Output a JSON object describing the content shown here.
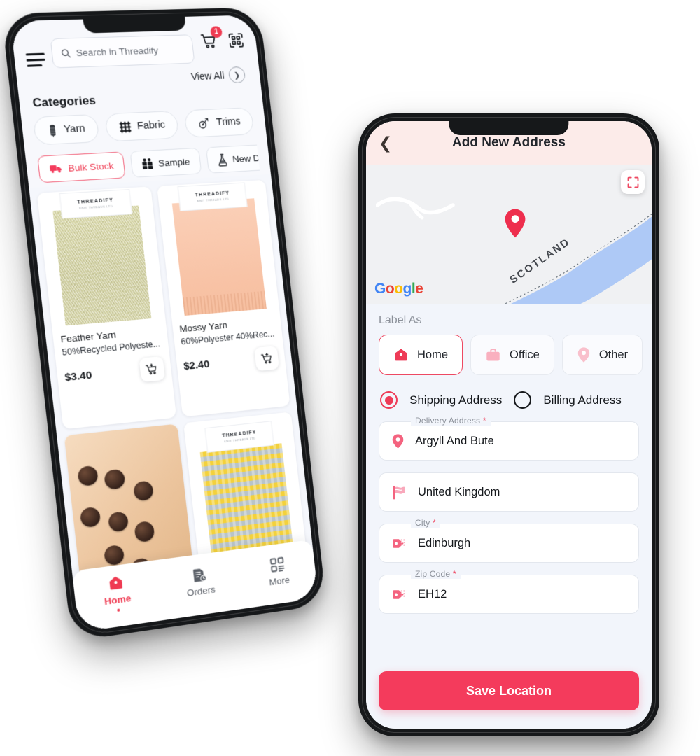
{
  "theme": {
    "accent": "#f43b5c",
    "accent_soft": "#f9b8c3",
    "header_pink": "#fcebe9",
    "screen_bg": "#f2f5fb",
    "page_bg": "#ffffff"
  },
  "left_phone": {
    "name": "Threadify Home Screen",
    "search": {
      "placeholder": "Search in Threadify"
    },
    "cart": {
      "badge": "1"
    },
    "view_all": {
      "label": "View All"
    },
    "categories": {
      "title": "Categories",
      "items": [
        {
          "label": "Yarn",
          "icon": "yarn-spool-icon"
        },
        {
          "label": "Fabric",
          "icon": "fabric-weave-icon"
        },
        {
          "label": "Trims",
          "icon": "trims-icon"
        }
      ]
    },
    "filters": [
      {
        "label": "Bulk Stock",
        "icon": "truck-icon",
        "active": true
      },
      {
        "label": "Sample",
        "icon": "gift-icon",
        "active": false
      },
      {
        "label": "New Develo",
        "icon": "flask-icon",
        "active": false
      }
    ],
    "products": [
      {
        "name": "Feather Yarn",
        "desc": "50%Recycled Polyeste...",
        "price": "$3.40",
        "brand_tag": "THREADIFY",
        "brand_sub": "KNIT THREADS LTD",
        "swatch": "feather"
      },
      {
        "name": "Mossy Yarn",
        "desc": "60%Polyester 40%Rec...",
        "price": "$2.40",
        "brand_tag": "THREADIFY",
        "brand_sub": "KNIT THREADS LTD",
        "swatch": "mossy"
      },
      {
        "name": "",
        "desc": "",
        "price": "",
        "brand_tag": "",
        "brand_sub": "",
        "swatch": "buttons"
      },
      {
        "name": "",
        "desc": "",
        "price": "",
        "brand_tag": "THREADIFY",
        "brand_sub": "KNIT THREADS LTD",
        "swatch": "chevron"
      }
    ],
    "tabs": [
      {
        "label": "Home",
        "icon": "home-icon",
        "active": true
      },
      {
        "label": "Orders",
        "icon": "orders-doc-icon",
        "active": false
      },
      {
        "label": "More",
        "icon": "grid-more-icon",
        "active": false
      }
    ]
  },
  "right_phone": {
    "name": "Add New Address Screen",
    "header": {
      "title": "Add New Address",
      "back_icon": "chevron-left-icon"
    },
    "map": {
      "region_label": "SCOTLAND",
      "attribution": "Google",
      "pin_icon": "map-pin-icon",
      "fullscreen_icon": "fullscreen-icon"
    },
    "label_as": {
      "title": "Label As",
      "options": [
        {
          "label": "Home",
          "icon": "home-icon",
          "selected": true
        },
        {
          "label": "Office",
          "icon": "briefcase-icon",
          "selected": false
        },
        {
          "label": "Other",
          "icon": "map-pin-icon",
          "selected": false
        }
      ]
    },
    "address_type": [
      {
        "label": "Shipping Address",
        "selected": true
      },
      {
        "label": "Billing Address",
        "selected": false
      }
    ],
    "fields": [
      {
        "label": "Delivery Address",
        "required": true,
        "value": "Argyll And Bute",
        "icon": "map-pin-icon",
        "show_label": true
      },
      {
        "label": "",
        "required": false,
        "value": "United Kingdom",
        "icon": "flag-icon",
        "show_label": false
      },
      {
        "label": "City",
        "required": true,
        "value": "Edinburgh",
        "icon": "city-tag-icon",
        "show_label": true
      },
      {
        "label": "Zip Code",
        "required": true,
        "value": "EH12",
        "icon": "city-tag-icon",
        "show_label": true
      }
    ],
    "save_button": {
      "label": "Save Location"
    }
  }
}
